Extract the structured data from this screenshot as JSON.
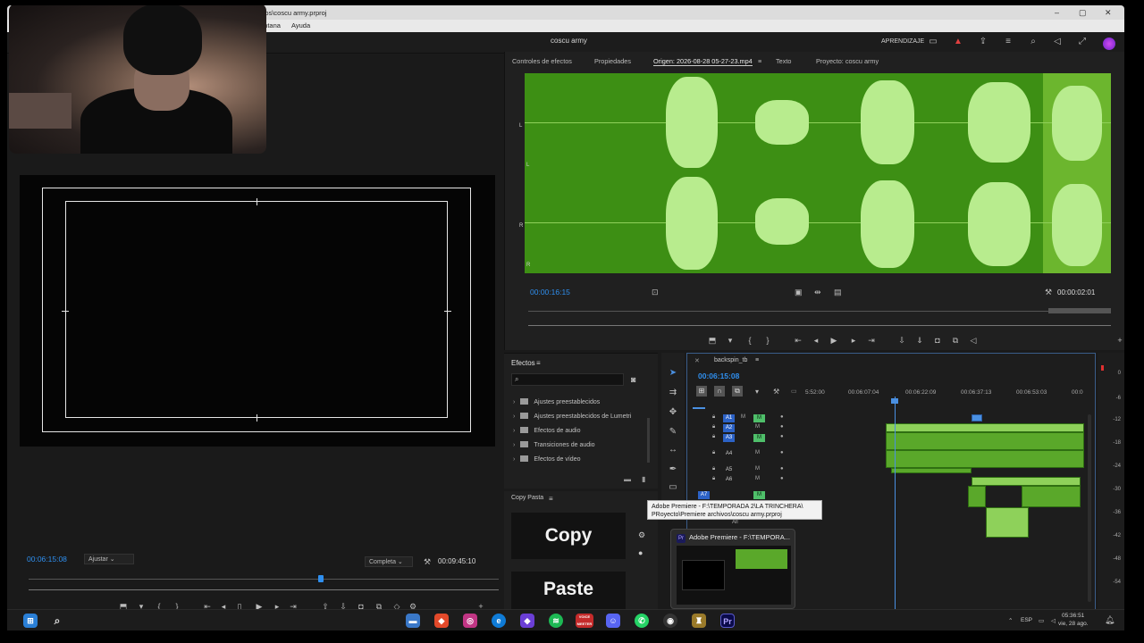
{
  "window": {
    "path": "ivos\\coscu army.prproj",
    "minimize": "–",
    "maximize": "▢",
    "close": "✕"
  },
  "menu": {
    "items": [
      "entana",
      "Ayuda"
    ]
  },
  "header": {
    "project_title": "coscu army",
    "learn": "APRENDIZAJE"
  },
  "source_panel": {
    "tabs": [
      "Controles de efectos",
      "Propiedades",
      "Origen: 2026-08-28 05-27-23.mp4",
      "Texto",
      "Proyecto: coscu army"
    ],
    "menu_glyph": "≡",
    "channel_L": "L",
    "channel_R": "R",
    "timecode": "00:00:16:15",
    "duration": "00:00:02:01"
  },
  "program_monitor": {
    "timecode": "00:06:15:08",
    "fit": "Ajustar",
    "quality": "Completa",
    "duration": "00:09:45:10"
  },
  "effects_panel": {
    "title": "Efectos",
    "menu_glyph": "≡",
    "items": [
      "Ajustes preestablecidos",
      "Ajustes preestablecidos de Lumetri",
      "Efectos de audio",
      "Transiciones de audio",
      "Efectos de vídeo"
    ]
  },
  "copypaste_panel": {
    "title": "Copy Pasta",
    "menu_glyph": "≡",
    "copy": "Copy",
    "paste": "Paste"
  },
  "timeline": {
    "sequence": "backspin_tb",
    "menu_glyph": "≡",
    "timecode": "00:06:15:08",
    "ruler": [
      "5:52:00",
      "00:06:07:04",
      "00:06:22:09",
      "00:06:37:13",
      "00:06:53:03",
      "00:0"
    ],
    "tracks": [
      {
        "name": "A1",
        "on": true,
        "m": "M"
      },
      {
        "name": "A2",
        "on": true,
        "m": "M"
      },
      {
        "name": "A3",
        "on": true,
        "m": "M"
      },
      {
        "name": "A4",
        "on": false,
        "m": "M"
      },
      {
        "name": "A5",
        "on": false,
        "m": "M"
      },
      {
        "name": "A6",
        "on": false,
        "m": "M"
      },
      {
        "name": "A7",
        "on": false,
        "m": "M"
      }
    ],
    "track_all": "All"
  },
  "meters": {
    "scale": [
      "0",
      "-6",
      "-12",
      "-18",
      "-24",
      "-30",
      "-36",
      "-42",
      "-48",
      "-54"
    ]
  },
  "tooltip": {
    "line1": "Adobe Premiere - F:\\TEMPORADA 2\\LA TRINCHERA\\",
    "line2": "PRoyecto\\Premiere archivos\\coscu army.prproj"
  },
  "thumb": {
    "title": "Adobe Premiere - F:\\TEMPORA...",
    "app_icon": "Pr"
  },
  "taskbar": {
    "apps": [
      "VOICE MEETER",
      "Pr"
    ],
    "lang": "ESP",
    "time": "05:36:51",
    "date": "vie, 28 ago."
  },
  "colors": {
    "accent": "#2f8fef",
    "waveform": "#3d8f14",
    "clip": "#5aa82a"
  }
}
